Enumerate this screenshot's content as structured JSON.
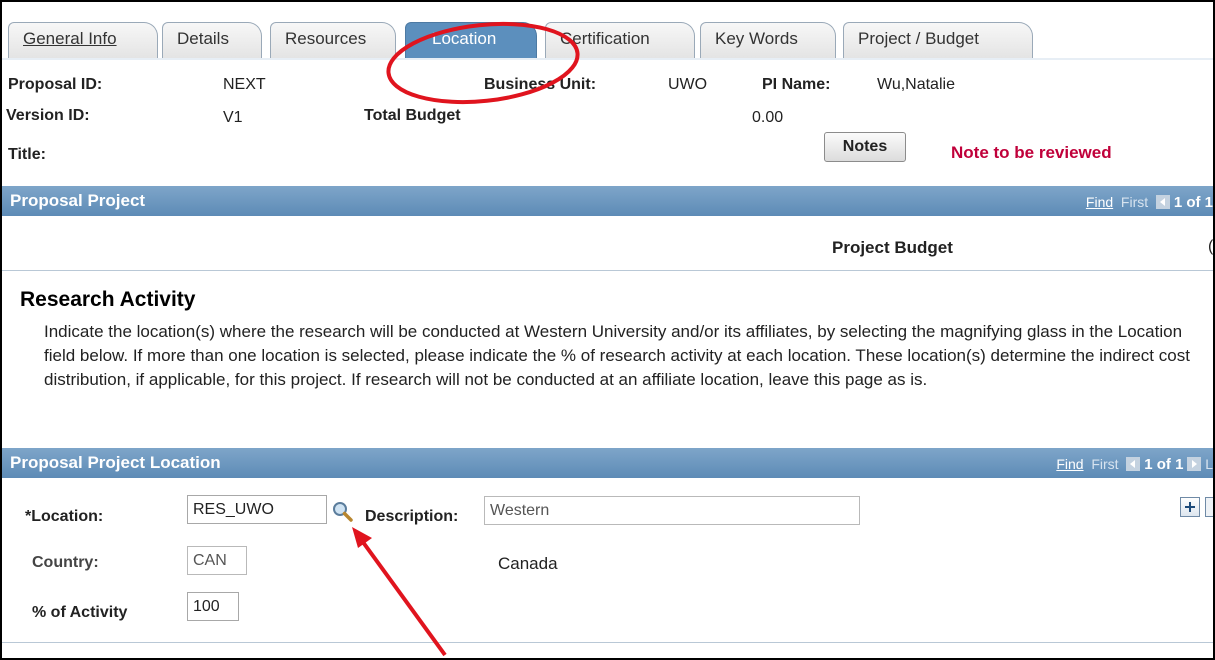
{
  "tabs": [
    {
      "label": "General Info"
    },
    {
      "label": "Details"
    },
    {
      "label": "Resources"
    },
    {
      "label": "Location"
    },
    {
      "label": "Certification"
    },
    {
      "label": "Key Words"
    },
    {
      "label": "Project / Budget"
    }
  ],
  "header": {
    "proposal_id_label": "Proposal ID:",
    "proposal_id": "NEXT",
    "business_unit_label": "Business Unit:",
    "business_unit": "UWO",
    "pi_name_label": "PI Name:",
    "pi_name": "Wu,Natalie",
    "version_id_label": "Version ID:",
    "version_id": "V1",
    "total_budget_label": "Total Budget",
    "total_budget": "0.00",
    "title_label": "Title:",
    "notes_button": "Notes",
    "note_status": "Note to be reviewed"
  },
  "proposal_project": {
    "title": "Proposal Project",
    "find": "Find",
    "first": "First",
    "count": "1 of 1",
    "project_budget_label": "Project Budget",
    "trailing_char": "("
  },
  "research": {
    "heading": "Research Activity",
    "text": "Indicate the location(s) where the research will be conducted at Western University and/or its affiliates, by selecting the magnifying glass in the Location field below. If more than one location is selected, please indicate the % of research activity at each location. These location(s) determine the indirect cost distribution, if applicable, for this project. If research will not be conducted at an affiliate location, leave this page as is."
  },
  "location_section": {
    "title": "Proposal Project Location",
    "find": "Find",
    "first": "First",
    "count": "1 of 1",
    "last": "L",
    "location_label": "*Location:",
    "location_value": "RES_UWO",
    "description_label": "Description:",
    "description_value": "Western",
    "country_label": "Country:",
    "country_code": "CAN",
    "country_name": "Canada",
    "activity_label": "% of Activity",
    "activity_value": "100"
  },
  "icons": {
    "lookup": "magnifying-glass-icon",
    "add_row": "plus-icon"
  },
  "colors": {
    "section_bar": "#5d8bb6",
    "active_tab": "#5c8fbd",
    "note_status": "#c0003a",
    "annotation": "#e0141e"
  }
}
